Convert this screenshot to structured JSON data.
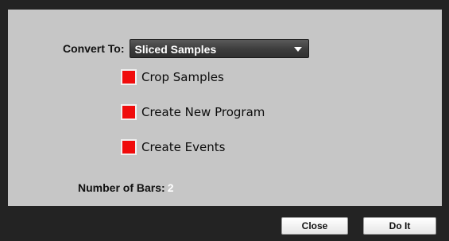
{
  "dialog": {
    "convert_label": "Convert To:",
    "convert_value": "Sliced Samples",
    "options": [
      {
        "label": "Crop Samples",
        "checked": true
      },
      {
        "label": "Create New Program",
        "checked": true
      },
      {
        "label": "Create Events",
        "checked": true
      }
    ],
    "bars_label": "Number of Bars:",
    "bars_value": "2",
    "checkbox_color": "#f00c0c",
    "panel_color": "#c6c6c6",
    "frame_color": "#232323"
  },
  "buttons": {
    "close_label": "Close",
    "doit_label": "Do It"
  }
}
